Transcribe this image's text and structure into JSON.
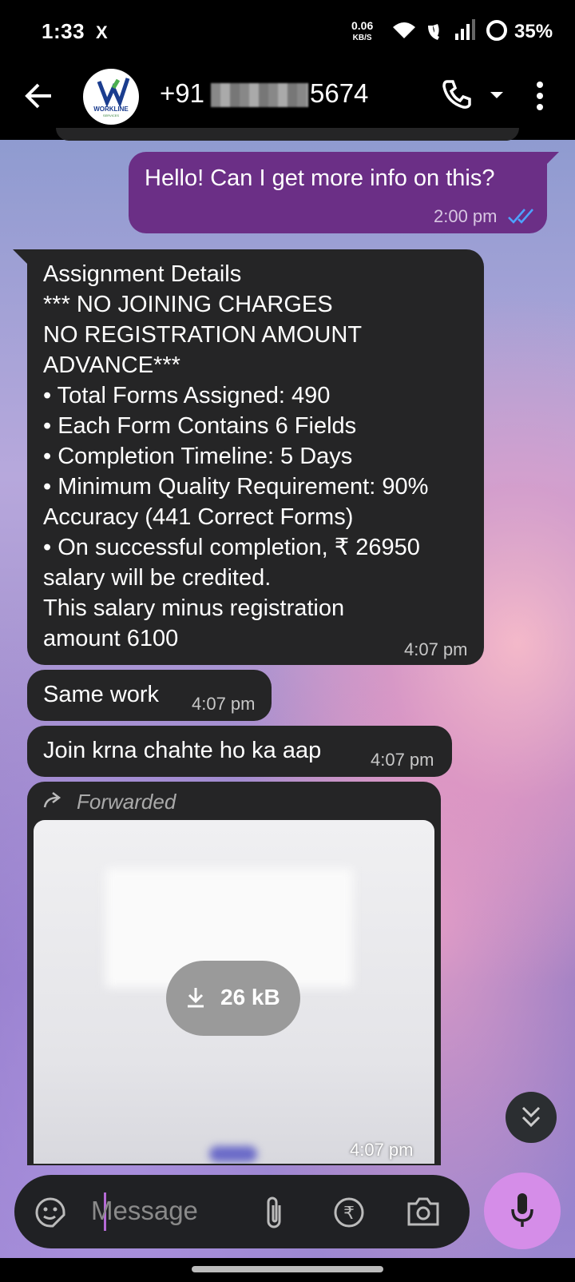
{
  "status_bar": {
    "time": "1:33",
    "app_icon": "X",
    "net_speed_value": "0.06",
    "net_speed_unit": "KB/S",
    "battery": "35%"
  },
  "header": {
    "avatar_text": "WORKLINE",
    "avatar_sub": "SERVICES",
    "contact_prefix": "+91",
    "contact_suffix": "5674"
  },
  "messages": [
    {
      "dir": "out",
      "text": "Hello! Can I get more info on this?",
      "time": "2:00 pm"
    },
    {
      "dir": "in",
      "text": "Assignment Details\n*** NO JOINING CHARGES\nNO REGISTRATION AMOUNT\nADVANCE***\n• Total Forms Assigned: 490\n• Each Form Contains 6 Fields\n• Completion Timeline: 5 Days\n• Minimum Quality Requirement: 90%\nAccuracy (441 Correct Forms)\n• On successful completion, ₹ 26950\nsalary will be credited.\nThis salary minus registration\namount 6100",
      "time": "4:07 pm"
    },
    {
      "dir": "in",
      "text": "Same work",
      "time": "4:07 pm"
    },
    {
      "dir": "in",
      "text": "Join krna chahte ho ka aap",
      "time": "4:07 pm"
    }
  ],
  "forwarded": {
    "label": "Forwarded",
    "download_size": "26 kB",
    "time": "4:07 pm"
  },
  "composer": {
    "placeholder": "Message"
  }
}
